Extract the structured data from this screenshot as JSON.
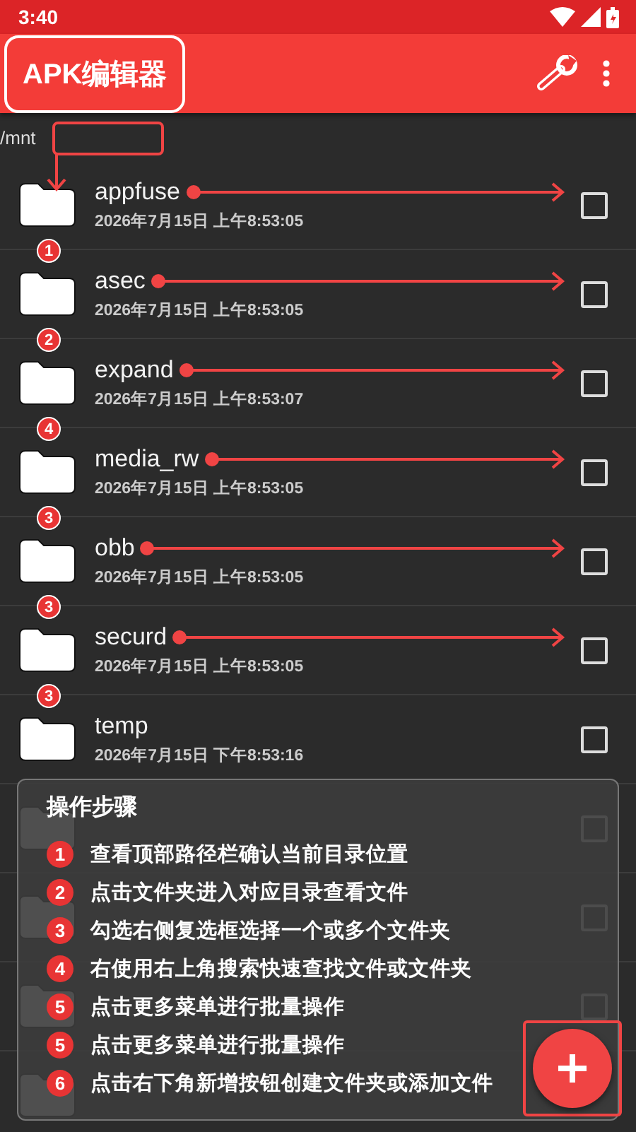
{
  "status_bar": {
    "time": "3:40"
  },
  "app_bar": {
    "title": "APK编辑器",
    "title_highlighted": true
  },
  "path": {
    "text": "/mnt",
    "callout": true
  },
  "folders": [
    {
      "name": "appfuse",
      "date": "2026年7月15日 上午8:53:05",
      "arrow": true,
      "checked": false
    },
    {
      "name": "asec",
      "date": "2026年7月15日 上午8:53:05",
      "badge": "1",
      "arrow": true,
      "checked": false
    },
    {
      "name": "expand",
      "date": "2026年7月15日 上午8:53:07",
      "badge": "2",
      "arrow": true,
      "checked": false
    },
    {
      "name": "media_rw",
      "date": "2026年7月15日 上午8:53:05",
      "badge": "4",
      "arrow": true,
      "checked": false
    },
    {
      "name": "obb",
      "date": "2026年7月15日 上午8:53:05",
      "badge": "3",
      "arrow": true,
      "checked": false
    },
    {
      "name": "securd",
      "date": "2026年7月15日 上午8:53:05",
      "badge": "3",
      "arrow": true,
      "checked": false
    },
    {
      "name": "temp",
      "date": "2026年7月15日 下午8:53:16",
      "badge": "3",
      "arrow": false,
      "checked": false
    }
  ],
  "covered_rows": [
    {
      "checked": false
    },
    {
      "checked": false
    },
    {
      "checked": false
    },
    {}
  ],
  "guide": {
    "title": "操作步骤",
    "steps": [
      {
        "number": "1",
        "text": "查看顶部路径栏确认当前目录位置"
      },
      {
        "number": "2",
        "text": "点击文件夹进入对应目录查看文件"
      },
      {
        "number": "3",
        "text": "勾选右侧复选框选择一个或多个文件夹"
      },
      {
        "number": "4",
        "text": "右使用右上角搜索快速查找文件或文件夹"
      },
      {
        "number": "5",
        "text": "点击更多菜单进行批量操作"
      },
      {
        "number": "5",
        "text": "点击更多菜单进行批量操作"
      },
      {
        "number": "6",
        "text": "点击右下角新增按钮创建文件夹或添加文件"
      }
    ]
  },
  "fab": {
    "highlighted": true
  }
}
